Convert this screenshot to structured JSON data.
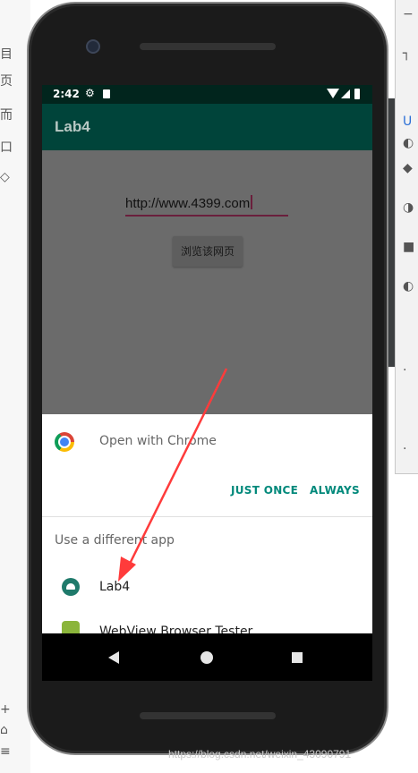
{
  "background": {
    "left_glyphs": [
      "目",
      "页",
      "而",
      "口",
      "◇",
      "+",
      "⌂",
      "≡"
    ],
    "right_glyphs": [
      "−",
      "┐",
      "U",
      "◐",
      "◆",
      "◑",
      "■",
      "◐",
      "·",
      "·"
    ]
  },
  "status_bar": {
    "time": "2:42"
  },
  "app_bar": {
    "title": "Lab4"
  },
  "content": {
    "url_value": "http://www.4399.com",
    "browse_button": "浏览该网页"
  },
  "sheet": {
    "open_with": "Open with Chrome",
    "just_once": "JUST ONCE",
    "always": "ALWAYS",
    "different_app": "Use a different app",
    "apps": [
      {
        "label": "Lab4"
      },
      {
        "label": "WebView Browser Tester"
      }
    ]
  },
  "watermark": "https://blog.csdn.net/weixin_43090791",
  "colors": {
    "app_bar": "#00443a",
    "status_bar": "#01251d",
    "accent": "#00897b",
    "annotation": "#ff3b3b"
  }
}
